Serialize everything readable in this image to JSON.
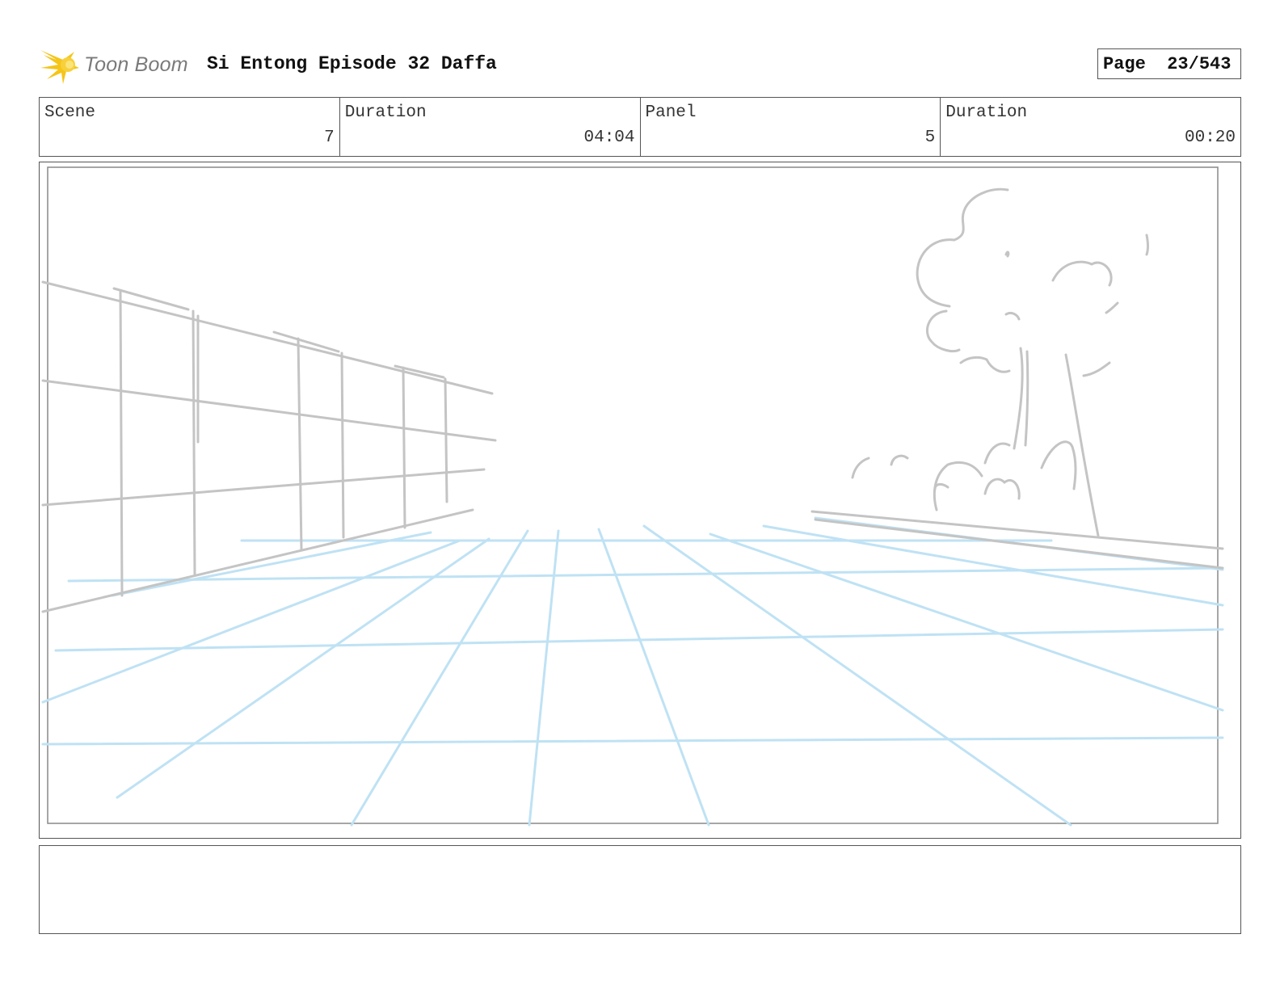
{
  "header": {
    "logo_text": "Toon Boom",
    "title": "Si Entong Episode 32 Daffa",
    "page_label": "Page",
    "page_number": "23/543"
  },
  "info": [
    {
      "label": "Scene",
      "value": "7"
    },
    {
      "label": "Duration",
      "value": "04:04"
    },
    {
      "label": "Panel",
      "value": "5"
    },
    {
      "label": "Duration",
      "value": "00:20"
    }
  ],
  "notes": {
    "text": ""
  },
  "colors": {
    "grid_blue": "#bfe2f4",
    "sketch_gray": "#c4c4c4",
    "logo_yellow": "#f5c518"
  }
}
